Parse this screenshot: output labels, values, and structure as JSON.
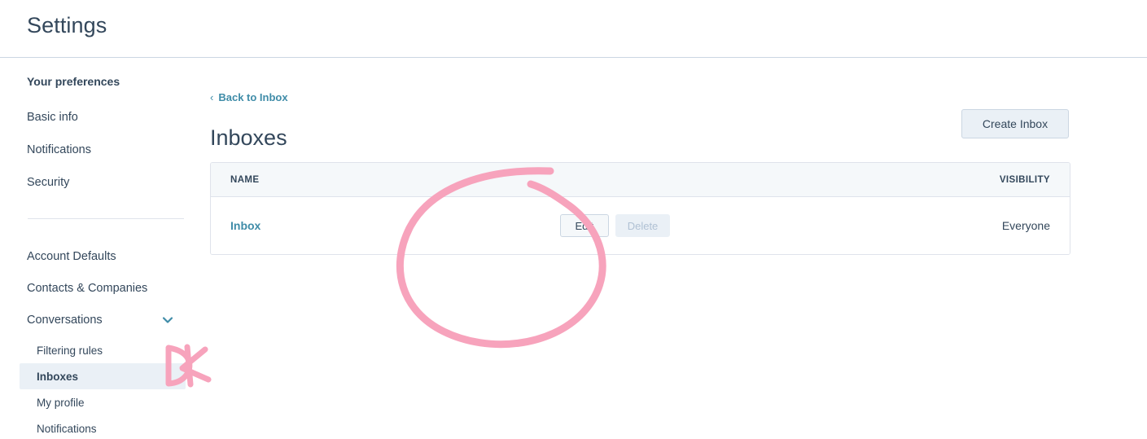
{
  "header": {
    "title": "Settings"
  },
  "sidebar": {
    "section_title": "Your preferences",
    "preference_items": [
      {
        "label": "Basic info"
      },
      {
        "label": "Notifications"
      },
      {
        "label": "Security"
      }
    ],
    "account_items": [
      {
        "label": "Account Defaults"
      },
      {
        "label": "Contacts & Companies"
      },
      {
        "label": "Conversations",
        "expanded": true,
        "chevron_icon": "chevron-down-icon"
      }
    ],
    "conversations_children": [
      {
        "label": "Filtering rules",
        "active": false
      },
      {
        "label": "Inboxes",
        "active": true
      },
      {
        "label": "My profile",
        "active": false
      },
      {
        "label": "Notifications",
        "active": false
      }
    ]
  },
  "main": {
    "back_link": {
      "label": "Back to Inbox",
      "chevron_icon": "chevron-left-icon"
    },
    "page_title": "Inboxes",
    "create_button_label": "Create Inbox",
    "table": {
      "columns": [
        "NAME",
        "VISIBILITY"
      ],
      "rows": [
        {
          "name": "Inbox",
          "edit_label": "Edit",
          "delete_label": "Delete",
          "delete_disabled": true,
          "visibility": "Everyone"
        }
      ]
    }
  },
  "annotations": {
    "color": "#f7a3bc",
    "circle_label": "hand-drawn-circle-around-edit-delete",
    "mark_label": "hand-drawn-dk-mark-near-inboxes"
  },
  "colors": {
    "text_primary": "#33475b",
    "link": "#3f8ca8",
    "button_fill": "#eaf0f6",
    "button_border": "#cbd6e2",
    "table_header_fill": "#f5f8fa",
    "border": "#dfe3eb",
    "annotation_pink": "#f7a3bc"
  }
}
